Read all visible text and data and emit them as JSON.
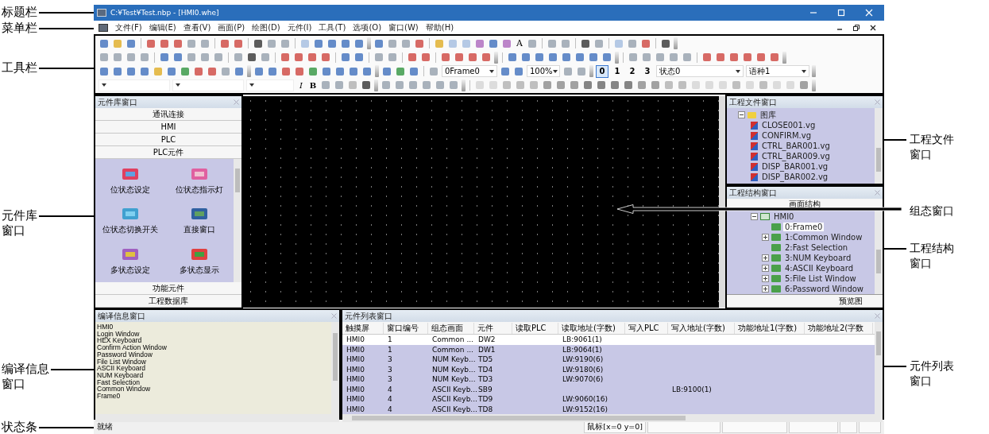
{
  "window": {
    "title": "C:¥Test¥Test.nbp - [HMI0.whe]"
  },
  "menu": [
    {
      "label": "文件(F)"
    },
    {
      "label": "编辑(E)"
    },
    {
      "label": "查看(V)"
    },
    {
      "label": "画面(P)"
    },
    {
      "label": "绘图(D)"
    },
    {
      "label": "元件(I)"
    },
    {
      "label": "工具(T)"
    },
    {
      "label": "选项(O)"
    },
    {
      "label": "窗口(W)"
    },
    {
      "label": "帮助(H)"
    }
  ],
  "toolbar": {
    "text_tool": "A",
    "frame_select": "0Frame0",
    "zoom_select": "100%",
    "state_buttons": [
      {
        "label": "0",
        "selected": true
      },
      {
        "label": "1",
        "selected": false
      },
      {
        "label": "2",
        "selected": false
      },
      {
        "label": "3",
        "selected": false
      }
    ],
    "state_select": "状态0",
    "language_select": "语种1",
    "style_buttons": [
      "I",
      "B"
    ]
  },
  "library": {
    "title": "元件库窗口",
    "categories_top": [
      "通讯连接",
      "HMI",
      "PLC",
      "PLC元件"
    ],
    "items": [
      {
        "label": "位状态设定"
      },
      {
        "label": "位状态指示灯"
      },
      {
        "label": "位状态切换开关"
      },
      {
        "label": "直接窗口"
      },
      {
        "label": "多状态设定"
      },
      {
        "label": "多状态显示"
      }
    ],
    "categories_bottom": [
      "功能元件",
      "工程数据库"
    ]
  },
  "project_files": {
    "title": "工程文件窗口",
    "tree": [
      {
        "label": "图库",
        "expanded": true,
        "children": [
          {
            "label": "CLOSE001.vg"
          },
          {
            "label": "CONFIRM.vg"
          },
          {
            "label": "CTRL_BAR001.vg"
          },
          {
            "label": "CTRL_BAR009.vg"
          },
          {
            "label": "DISP_BAR001.vg"
          },
          {
            "label": "DISP_BAR002.vg"
          }
        ]
      }
    ]
  },
  "project_structure": {
    "title": "工程结构窗口",
    "tab": "画面结构",
    "tree": [
      {
        "label": "HMI0",
        "expanded": true,
        "children": [
          {
            "label": "0:Frame0",
            "selected": true
          },
          {
            "label": "1:Common Window",
            "selected": false,
            "expanded": false,
            "has_children": true
          },
          {
            "label": "2:Fast Selection",
            "selected": false
          },
          {
            "label": "3:NUM Keyboard",
            "selected": false,
            "expanded": false,
            "has_children": true
          },
          {
            "label": "4:ASCII Keyboard",
            "selected": false,
            "expanded": false,
            "has_children": true
          },
          {
            "label": "5:File List Window",
            "selected": false,
            "expanded": false,
            "has_children": true
          },
          {
            "label": "6:Password Window",
            "selected": false,
            "expanded": false,
            "has_children": true
          }
        ]
      }
    ],
    "bottom_tab": "预览图"
  },
  "compile_info": {
    "title": "编译信息窗口",
    "lines": [
      "HMI0",
      "Login Window",
      "HEX Keyboard",
      "Confirm Action Window",
      "Password Window",
      "File List Window",
      "ASCII Keyboard",
      "NUM Keyboard",
      "Fast Selection",
      "Common Window",
      "Frame0"
    ]
  },
  "element_list": {
    "title": "元件列表窗口",
    "columns": [
      {
        "label": "触摸屏"
      },
      {
        "label": "窗口编号"
      },
      {
        "label": "组态画面"
      },
      {
        "label": "元件"
      },
      {
        "label": "读取PLC"
      },
      {
        "label": "读取地址(字数)"
      },
      {
        "label": "写入PLC"
      },
      {
        "label": "写入地址(字数)"
      },
      {
        "label": "功能地址1(字数)"
      },
      {
        "label": "功能地址2(字数"
      }
    ],
    "rows": [
      {
        "hmi": "HMI0",
        "window": "1",
        "screen": "Common ...",
        "element": "DW2",
        "read_addr": "LB:9061(1)",
        "selected": false
      },
      {
        "hmi": "HMI0",
        "window": "1",
        "screen": "Common ...",
        "element": "DW1",
        "read_addr": "LB:9064(1)",
        "selected": true
      },
      {
        "hmi": "HMI0",
        "window": "3",
        "screen": "NUM Keyb...",
        "element": "TD5",
        "read_addr": "LW:9190(6)",
        "selected": true
      },
      {
        "hmi": "HMI0",
        "window": "3",
        "screen": "NUM Keyb...",
        "element": "TD4",
        "read_addr": "LW:9180(6)",
        "selected": true
      },
      {
        "hmi": "HMI0",
        "window": "3",
        "screen": "NUM Keyb...",
        "element": "TD3",
        "read_addr": "LW:9070(6)",
        "selected": true
      },
      {
        "hmi": "HMI0",
        "window": "4",
        "screen": "ASCII Keyb...",
        "element": "SB9",
        "write_addr": "LB:9100(1)",
        "selected": true
      },
      {
        "hmi": "HMI0",
        "window": "4",
        "screen": "ASCII Keyb...",
        "element": "TD9",
        "read_addr": "LW:9060(16)",
        "selected": true
      },
      {
        "hmi": "HMI0",
        "window": "4",
        "screen": "ASCII Keyb...",
        "element": "TD8",
        "read_addr": "LW:9152(16)",
        "selected": true
      }
    ]
  },
  "status_bar": {
    "message": "就绪",
    "mouse": "鼠标[x=0  y=0]"
  },
  "callouts_left": [
    {
      "text": "标题栏"
    },
    {
      "text": "菜单栏"
    },
    {
      "text": "工具栏"
    },
    {
      "text": "元件库窗口"
    },
    {
      "text": "编译信息窗口"
    },
    {
      "text": "状态条"
    }
  ],
  "callouts_right": [
    {
      "text": "工程文件窗口"
    },
    {
      "text": "组态窗口"
    },
    {
      "text": "工程结构窗口"
    },
    {
      "text": "元件列表窗口"
    }
  ]
}
